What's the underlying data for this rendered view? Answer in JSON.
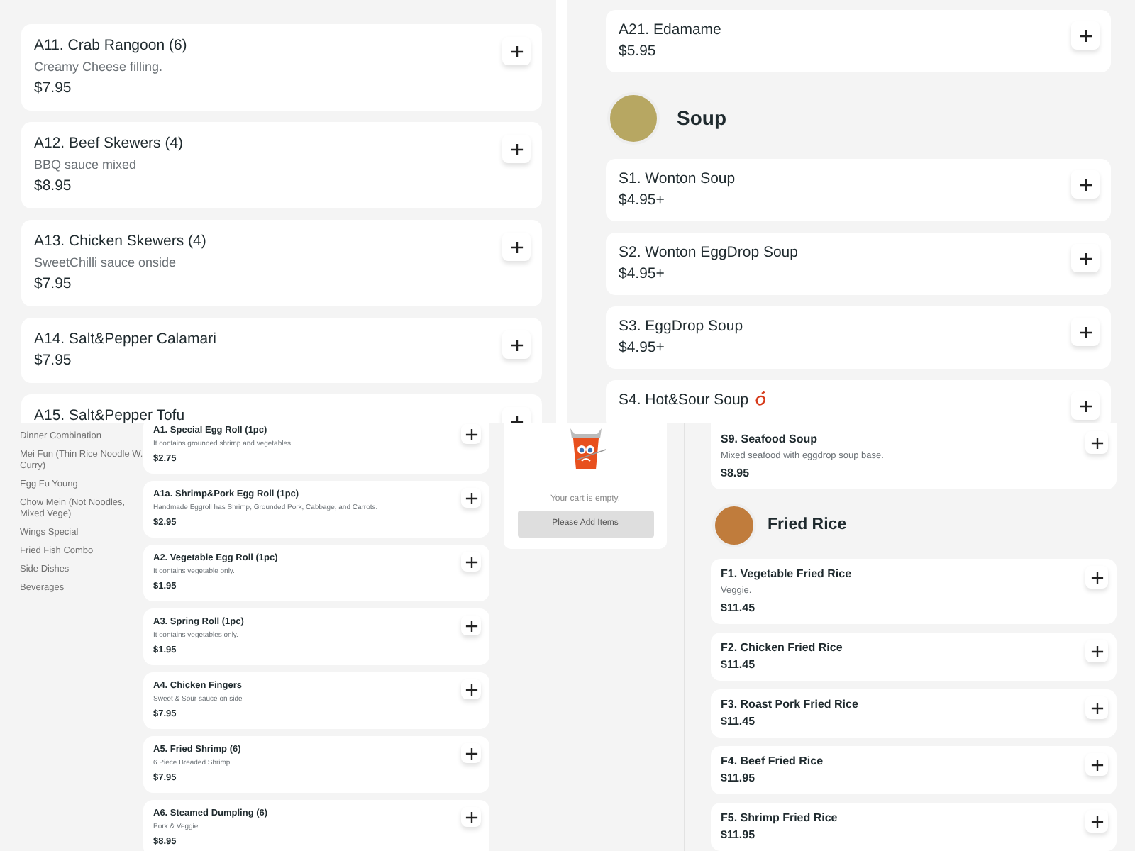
{
  "panels": [
    {
      "kind": "menu",
      "blocks": [
        {
          "kind": "item",
          "name": "A11. Crab Rangoon (6)",
          "description": "Creamy Cheese filling.",
          "price": "$7.95",
          "spicy": false
        },
        {
          "kind": "item",
          "name": "A12. Beef Skewers (4)",
          "description": "BBQ sauce mixed",
          "price": "$8.95",
          "spicy": false
        },
        {
          "kind": "item",
          "name": "A13. Chicken Skewers (4)",
          "description": "SweetChilli sauce onside",
          "price": "$7.95",
          "spicy": false
        },
        {
          "kind": "item",
          "name": "A14. Salt&Pepper Calamari",
          "price": "$7.95",
          "spicy": false
        },
        {
          "kind": "item",
          "name": "A15. Salt&Pepper Tofu",
          "spicy": false
        }
      ]
    },
    {
      "kind": "menu",
      "blocks": [
        {
          "kind": "item",
          "name": "A21. Edamame",
          "price": "$5.95",
          "spicy": false
        },
        {
          "kind": "heading",
          "title": "Soup"
        },
        {
          "kind": "item",
          "name": "S1. Wonton Soup",
          "price": "$4.95+",
          "spicy": false
        },
        {
          "kind": "item",
          "name": "S2. Wonton EggDrop Soup",
          "price": "$4.95+",
          "spicy": false
        },
        {
          "kind": "item",
          "name": "S3. EggDrop Soup",
          "price": "$4.95+",
          "spicy": false
        },
        {
          "kind": "item",
          "name": "S4. Hot&Sour Soup",
          "spicy": true
        }
      ]
    },
    {
      "kind": "store",
      "sidebar": [
        "Dinner Combination",
        "Mei Fun (Thin Rice Noodle W. Curry)",
        "Egg Fu Young",
        "Chow Mein (Not Noodles, Mixed Vege)",
        "Wings Special",
        "Fried Fish Combo",
        "Side Dishes",
        "Beverages"
      ],
      "items": [
        {
          "kind": "item",
          "name": "A1. Special Egg Roll (1pc)",
          "description": "It contains grounded shrimp and vegetables.",
          "price": "$2.75",
          "spicy": false
        },
        {
          "kind": "item",
          "name": "A1a. Shrimp&Pork Egg Roll (1pc)",
          "description": "Handmade Eggroll has Shrimp, Grounded Pork, Cabbage, and Carrots.",
          "price": "$2.95",
          "spicy": false
        },
        {
          "kind": "item",
          "name": "A2. Vegetable Egg Roll (1pc)",
          "description": "It contains vegetable only.",
          "price": "$1.95",
          "spicy": false
        },
        {
          "kind": "item",
          "name": "A3. Spring Roll (1pc)",
          "description": "It contains vegetables only.",
          "price": "$1.95",
          "spicy": false
        },
        {
          "kind": "item",
          "name": "A4. Chicken Fingers",
          "description": "Sweet & Sour sauce on side",
          "price": "$7.95",
          "spicy": false
        },
        {
          "kind": "item",
          "name": "A5. Fried Shrimp (6)",
          "description": "6 Piece Breaded Shrimp.",
          "price": "$7.95",
          "spicy": false
        },
        {
          "kind": "item",
          "name": "A6. Steamed Dumpling (6)",
          "description": "Pork & Veggie",
          "price": "$8.95",
          "spicy": false
        }
      ],
      "cart": {
        "message": "Your cart is empty.",
        "button": "Please Add Items"
      }
    },
    {
      "kind": "menu",
      "blocks": [
        {
          "kind": "item",
          "name": "S9. Seafood Soup",
          "description": "Mixed seafood with eggdrop soup base.",
          "price": "$8.95",
          "spicy": false
        },
        {
          "kind": "heading",
          "title": "Fried Rice"
        },
        {
          "kind": "item",
          "name": "F1. Vegetable Fried Rice",
          "description": "Veggie.",
          "price": "$11.45",
          "spicy": false
        },
        {
          "kind": "item",
          "name": "F2. Chicken Fried Rice",
          "price": "$11.45",
          "spicy": false
        },
        {
          "kind": "item",
          "name": "F3. Roast Pork Fried Rice",
          "price": "$11.45",
          "spicy": false
        },
        {
          "kind": "item",
          "name": "F4. Beef Fried Rice",
          "price": "$11.95",
          "spicy": false
        },
        {
          "kind": "item",
          "name": "F5. Shrimp Fried Rice",
          "price": "$11.95",
          "spicy": false
        }
      ]
    }
  ]
}
